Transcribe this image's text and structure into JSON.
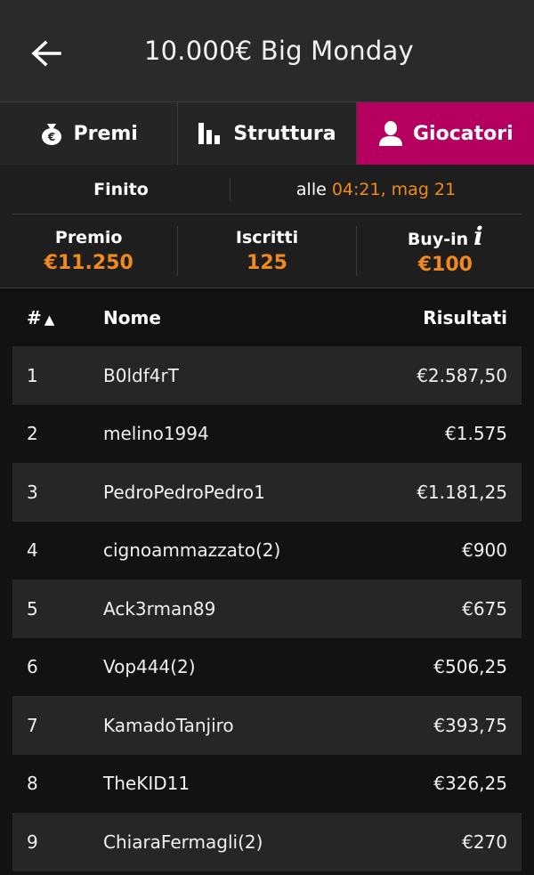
{
  "header": {
    "title": "10.000€ Big Monday"
  },
  "tabs": [
    {
      "label": "Premi",
      "icon": "money-bag-icon",
      "active": false
    },
    {
      "label": "Struttura",
      "icon": "bar-chart-icon",
      "active": false
    },
    {
      "label": "Giocatori",
      "icon": "user-icon",
      "active": true
    }
  ],
  "status": {
    "state": "Finito",
    "prefix": "alle",
    "datetime": "04:21, mag 21"
  },
  "stats": [
    {
      "label": "Premio",
      "value": "€11.250"
    },
    {
      "label": "Iscritti",
      "value": "125"
    },
    {
      "label": "Buy-in",
      "value": "€100",
      "info": "i"
    }
  ],
  "table": {
    "headers": {
      "rank": "#",
      "name": "Nome",
      "result": "Risultati"
    },
    "sort_indicator": "▲",
    "rows": [
      {
        "rank": "1",
        "name": "B0ldf4rT",
        "result": "€2.587,50"
      },
      {
        "rank": "2",
        "name": "melino1994",
        "result": "€1.575"
      },
      {
        "rank": "3",
        "name": "PedroPedroPedro1",
        "result": "€1.181,25"
      },
      {
        "rank": "4",
        "name": "cignoammazzato(2)",
        "result": "€900"
      },
      {
        "rank": "5",
        "name": "Ack3rman89",
        "result": "€675"
      },
      {
        "rank": "6",
        "name": "Vop444(2)",
        "result": "€506,25"
      },
      {
        "rank": "7",
        "name": "KamadoTanjiro",
        "result": "€393,75"
      },
      {
        "rank": "8",
        "name": "TheKID11",
        "result": "€326,25"
      },
      {
        "rank": "9",
        "name": "ChiaraFermagli(2)",
        "result": "€270"
      }
    ]
  },
  "colors": {
    "accent": "#b5005f",
    "highlight": "#f08a1c"
  }
}
